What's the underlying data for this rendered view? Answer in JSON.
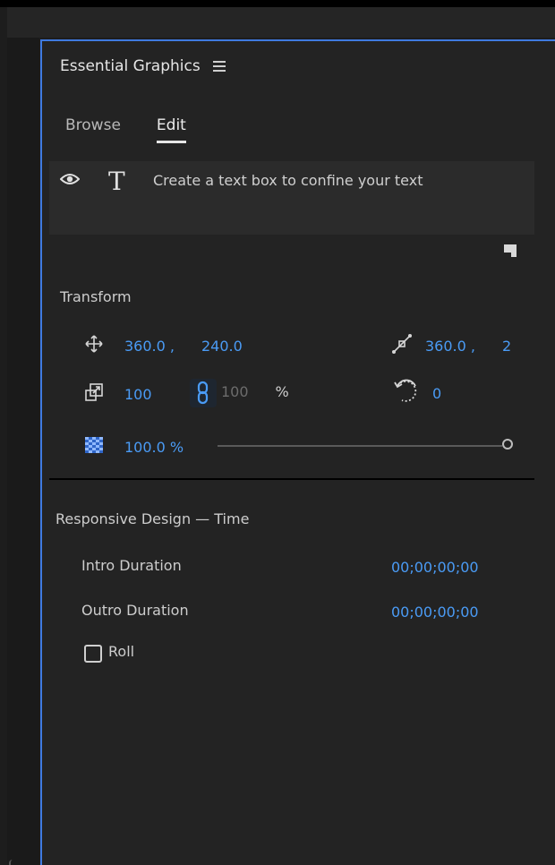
{
  "panel": {
    "title": "Essential Graphics",
    "menu_icon": "hamburger-menu-icon"
  },
  "tabs": [
    {
      "label": "Browse",
      "active": false
    },
    {
      "label": "Edit",
      "active": true
    }
  ],
  "layers": {
    "text": "Create a text box to confine your text",
    "visibility_icon": "eye-icon",
    "type_icon": "text-tool-icon",
    "new_layer_icon": "new-layer-icon"
  },
  "transform": {
    "title": "Transform",
    "position_x": "360.0 ,",
    "position_y": "240.0",
    "anchor_x": "360.0 ,",
    "anchor_y": "2",
    "scale": "100",
    "scale_height": "100",
    "scale_unit": "%",
    "rotation": "0",
    "opacity": "100.0 %",
    "opacity_fraction": 1.0
  },
  "responsive": {
    "title": "Responsive Design — Time",
    "intro_label": "Intro Duration",
    "intro_value": "00;00;00;00",
    "outro_label": "Outro Duration",
    "outro_value": "00;00;00;00",
    "roll_label": "Roll",
    "roll_checked": false
  },
  "colors": {
    "accent": "#4a9bf5",
    "panel_border": "#3f7ae0",
    "panel_bg": "#232323"
  }
}
